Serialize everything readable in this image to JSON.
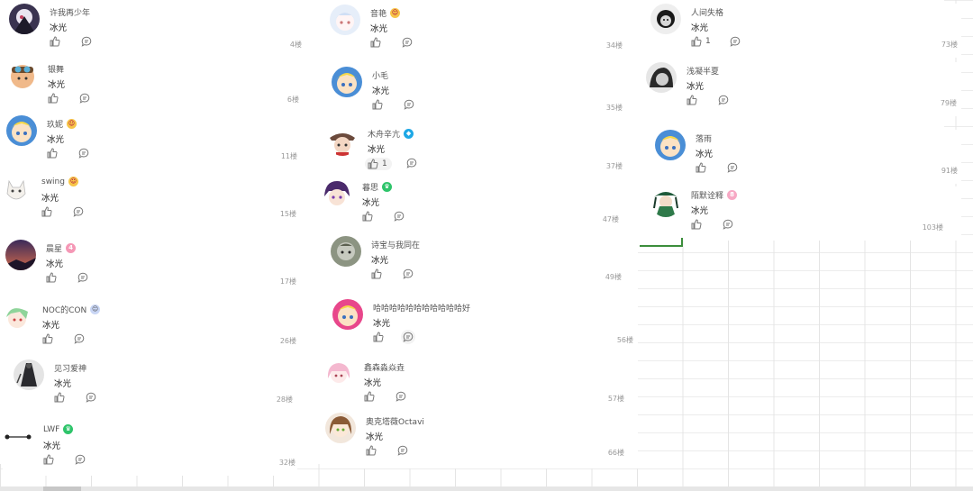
{
  "comments": [
    {
      "user": "许我再少年",
      "text": "冰光",
      "floor": "4楼",
      "likes": "",
      "badge": "",
      "avatar": "anime-dark"
    },
    {
      "user": "银舞",
      "text": "冰光",
      "floor": "6楼",
      "likes": "",
      "badge": "",
      "avatar": "goggles"
    },
    {
      "user": "玖妮",
      "text": "冰光",
      "floor": "11楼",
      "likes": "",
      "badge": "emoji",
      "avatar": "blonde"
    },
    {
      "user": "swing",
      "text": "冰光",
      "floor": "15楼",
      "likes": "",
      "badge": "emoji",
      "avatar": "cat"
    },
    {
      "user": "晨星",
      "text": "冰光",
      "floor": "17楼",
      "likes": "",
      "badge": "4",
      "avatar": "sky"
    },
    {
      "user": "NOC的CON",
      "text": "冰光",
      "floor": "26楼",
      "likes": "",
      "badge": "emoji",
      "avatar": "green-hair"
    },
    {
      "user": "见习爱神",
      "text": "冰光",
      "floor": "28楼",
      "likes": "",
      "badge": "",
      "avatar": "dark-figure"
    },
    {
      "user": "LWF",
      "text": "冰光",
      "floor": "32楼",
      "likes": "",
      "badge": "crown",
      "avatar": "bar"
    },
    {
      "user": "音艳",
      "text": "冰光",
      "floor": "34楼",
      "likes": "",
      "badge": "emoji",
      "avatar": "pale"
    },
    {
      "user": "小毛",
      "text": "冰光",
      "floor": "35楼",
      "likes": "",
      "badge": "",
      "avatar": "blonde"
    },
    {
      "user": "木舟辛亢",
      "text": "冰光",
      "floor": "37楼",
      "likes": "1",
      "badge": "vip",
      "avatar": "hat"
    },
    {
      "user": "暮思",
      "text": "冰光",
      "floor": "47楼",
      "likes": "",
      "badge": "crown",
      "avatar": "purple"
    },
    {
      "user": "诗宝与我同在",
      "text": "冰光",
      "floor": "49楼",
      "likes": "",
      "badge": "",
      "avatar": "grey-char"
    },
    {
      "user": "哈哈哈哈哈哈哈哈哈哈哈好",
      "text": "冰光",
      "floor": "56楼",
      "likes": "",
      "badge": "",
      "avatar": "pink-blonde"
    },
    {
      "user": "鑫森淼焱垚",
      "text": "冰光",
      "floor": "57楼",
      "likes": "",
      "badge": "",
      "avatar": "pink-girl"
    },
    {
      "user": "奥克塔薇Octavi",
      "text": "冰光",
      "floor": "66楼",
      "likes": "",
      "badge": "",
      "avatar": "brown-girl"
    },
    {
      "user": "人间失格",
      "text": "冰光",
      "floor": "73楼",
      "likes": "1",
      "badge": "",
      "avatar": "bw"
    },
    {
      "user": "浅凝半夏",
      "text": "冰光",
      "floor": "79楼",
      "likes": "",
      "badge": "",
      "avatar": "bw2"
    },
    {
      "user": "落雨",
      "text": "冰光",
      "floor": "91楼",
      "likes": "",
      "badge": "",
      "avatar": "blonde"
    },
    {
      "user": "陌默诠释",
      "text": "冰光",
      "floor": "103楼",
      "likes": "",
      "badge": "8",
      "avatar": "green-char"
    }
  ],
  "colors": {
    "accent_green": "#3c8e3c",
    "badge_pink": "#f598b6",
    "badge_blue": "#1ea8e6",
    "badge_green": "#2ec46a",
    "grid_line": "#e4e4e4"
  },
  "icons": {
    "like": "thumbs-up-icon",
    "reply": "comment-bubble-icon"
  }
}
